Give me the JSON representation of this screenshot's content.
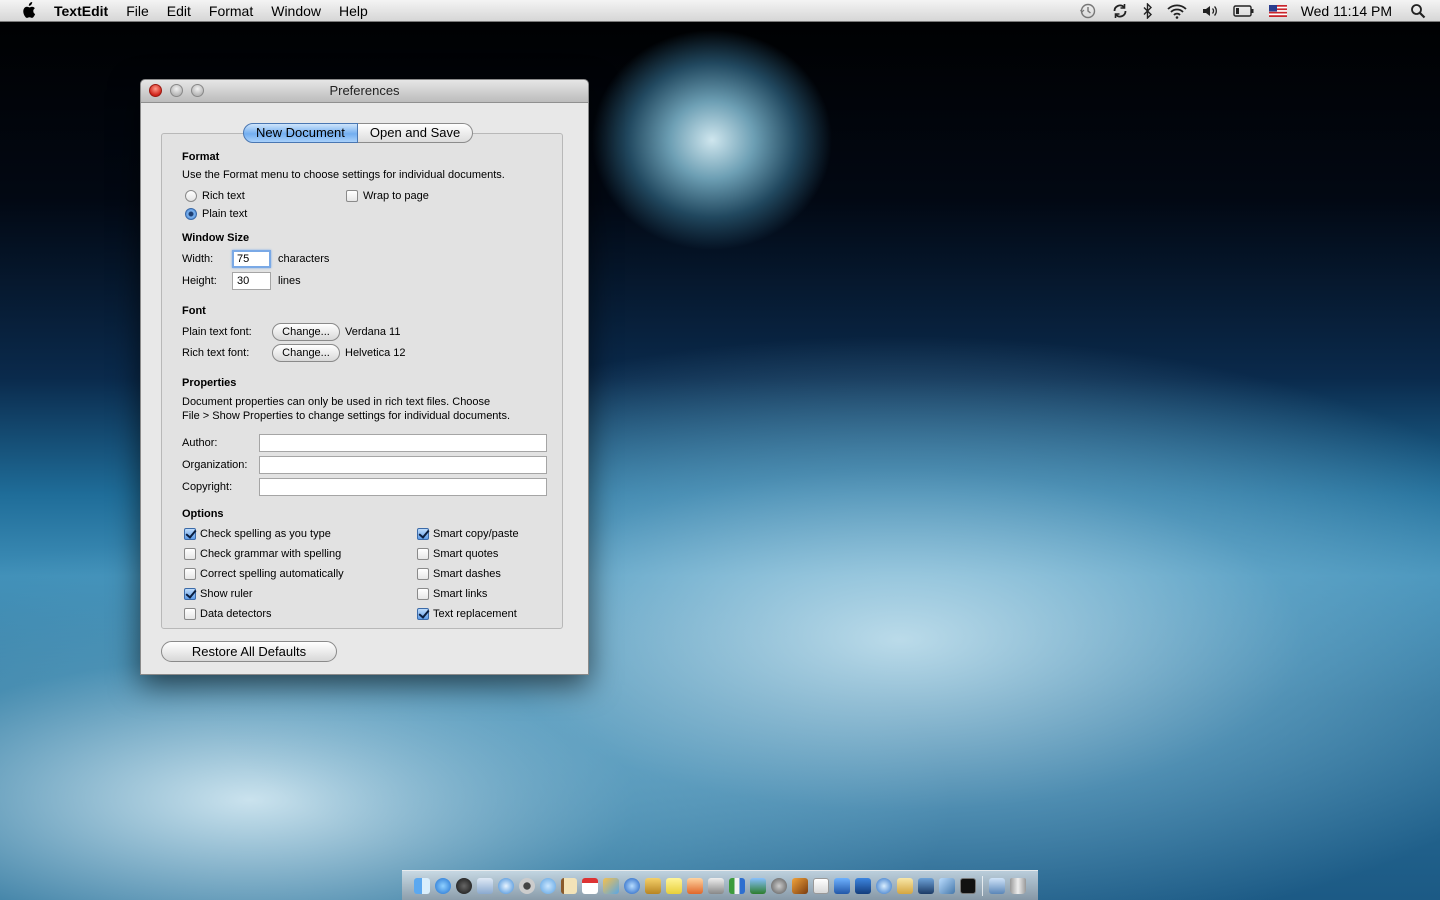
{
  "menubar": {
    "app_name": "TextEdit",
    "items": [
      "File",
      "Edit",
      "Format",
      "Window",
      "Help"
    ],
    "clock": "Wed 11:14 PM"
  },
  "window": {
    "title": "Preferences",
    "tabs": [
      {
        "label": "New Document",
        "selected": true
      },
      {
        "label": "Open and Save",
        "selected": false
      }
    ],
    "format": {
      "heading": "Format",
      "description": "Use the Format menu to choose settings for individual documents.",
      "rich_text_label": "Rich text",
      "plain_text_label": "Plain text",
      "selected": "Plain text",
      "wrap_label": "Wrap to page",
      "wrap_checked": false
    },
    "window_size": {
      "heading": "Window Size",
      "width_label": "Width:",
      "width_value": "75",
      "width_unit": "characters",
      "height_label": "Height:",
      "height_value": "30",
      "height_unit": "lines"
    },
    "font": {
      "heading": "Font",
      "plain_label": "Plain text font:",
      "plain_button": "Change...",
      "plain_value": "Verdana 11",
      "rich_label": "Rich text font:",
      "rich_button": "Change...",
      "rich_value": "Helvetica 12"
    },
    "properties": {
      "heading": "Properties",
      "description_line1": "Document properties can only be used in rich text files. Choose",
      "description_line2": "File > Show Properties to change settings for individual documents.",
      "author_label": "Author:",
      "author_value": "",
      "organization_label": "Organization:",
      "organization_value": "",
      "copyright_label": "Copyright:",
      "copyright_value": ""
    },
    "options": {
      "heading": "Options",
      "left": [
        {
          "label": "Check spelling as you type",
          "checked": true
        },
        {
          "label": "Check grammar with spelling",
          "checked": false
        },
        {
          "label": "Correct spelling automatically",
          "checked": false
        },
        {
          "label": "Show ruler",
          "checked": true
        },
        {
          "label": "Data detectors",
          "checked": false
        }
      ],
      "right": [
        {
          "label": "Smart copy/paste",
          "checked": true
        },
        {
          "label": "Smart quotes",
          "checked": false
        },
        {
          "label": "Smart dashes",
          "checked": false
        },
        {
          "label": "Smart links",
          "checked": false
        },
        {
          "label": "Text replacement",
          "checked": true
        }
      ]
    },
    "restore_button": "Restore All Defaults"
  },
  "colors": {
    "selection_blue": "#73aef0",
    "close_red": "#d0231a"
  }
}
